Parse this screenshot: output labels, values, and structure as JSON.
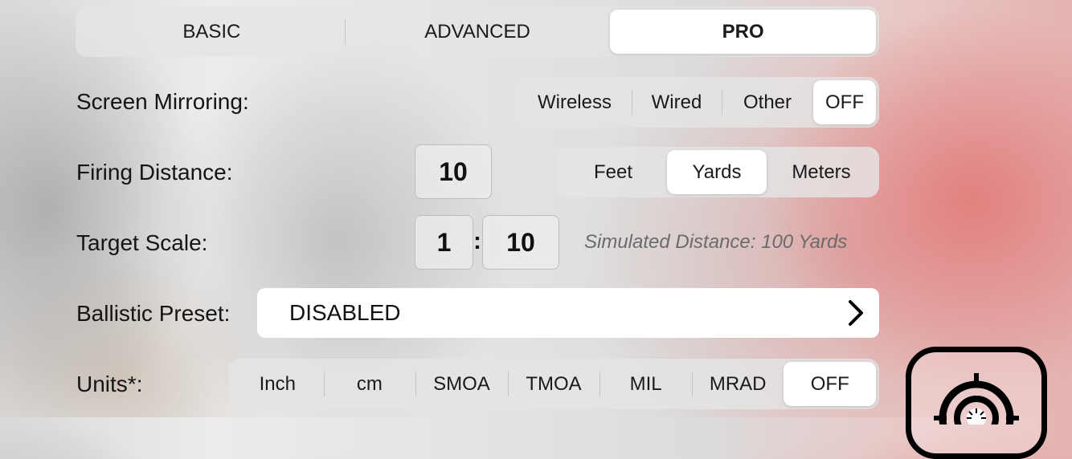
{
  "mode_tabs": [
    "BASIC",
    "ADVANCED",
    "PRO"
  ],
  "mode_selected": "PRO",
  "screen_mirroring": {
    "label": "Screen Mirroring:",
    "options": [
      "Wireless",
      "Wired",
      "Other",
      "OFF"
    ],
    "selected": "OFF"
  },
  "firing_distance": {
    "label": "Firing Distance:",
    "value": "10",
    "units": [
      "Feet",
      "Yards",
      "Meters"
    ],
    "selected": "Yards"
  },
  "target_scale": {
    "label": "Target Scale:",
    "left": "1",
    "separator": ":",
    "right": "10",
    "note": "Simulated Distance: 100 Yards"
  },
  "ballistic_preset": {
    "label": "Ballistic Preset:",
    "value": "DISABLED",
    "chevron_icon": "chevron-right-icon"
  },
  "units": {
    "label": "Units*:",
    "options": [
      "Inch",
      "cm",
      "SMOA",
      "TMOA",
      "MIL",
      "MRAD",
      "OFF"
    ],
    "selected": "OFF"
  },
  "target_button_icon": "target-reticle-icon"
}
